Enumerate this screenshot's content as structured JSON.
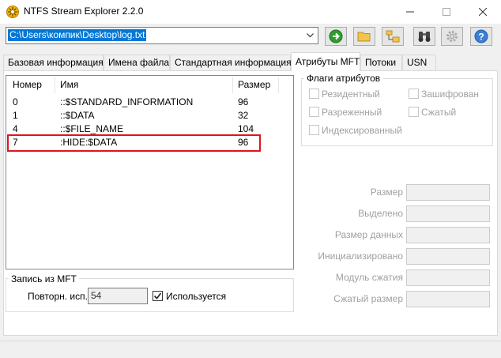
{
  "window": {
    "title": "NTFS Stream Explorer 2.2.0"
  },
  "path": {
    "value": "C:\\Users\\компик\\Desktop\\log.txt"
  },
  "tabs": [
    {
      "label": "Базовая информация"
    },
    {
      "label": "Имена файла"
    },
    {
      "label": "Стандартная информация"
    },
    {
      "label": "Атрибуты MFT"
    },
    {
      "label": "Потоки"
    },
    {
      "label": "USN"
    }
  ],
  "list": {
    "columns": [
      "Номер",
      "Имя",
      "Размер"
    ],
    "rows": [
      {
        "num": "0",
        "name": "::$STANDARD_INFORMATION",
        "size": "96"
      },
      {
        "num": "1",
        "name": "::$DATA",
        "size": "32"
      },
      {
        "num": "4",
        "name": "::$FILE_NAME",
        "size": "104"
      },
      {
        "num": "7",
        "name": ":HIDE:$DATA",
        "size": "96"
      }
    ]
  },
  "flags": {
    "title": "Флаги атрибутов",
    "resident": "Резидентный",
    "encrypted": "Зашифрован",
    "sparse": "Разреженный",
    "compressed": "Сжатый",
    "indexed": "Индексированный"
  },
  "fields": {
    "size": "Размер",
    "allocated": "Выделено",
    "data_size": "Размер данных",
    "initialized": "Инициализировано",
    "compression_unit": "Модуль сжатия",
    "compressed_size": "Сжатый размер"
  },
  "mft": {
    "title": "Запись из MFT",
    "reuse_label": "Повторн. исп.",
    "reuse_value": "54",
    "in_use_label": "Используется",
    "in_use_checked": true
  },
  "colors": {
    "accent": "#0078d7",
    "highlight": "#e0141e"
  }
}
